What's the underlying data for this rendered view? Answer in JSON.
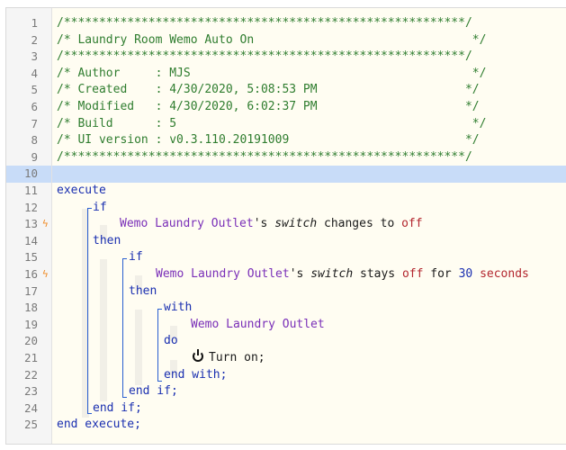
{
  "editor": {
    "line_numbers": [
      "1",
      "2",
      "3",
      "4",
      "5",
      "6",
      "7",
      "8",
      "9",
      "10",
      "11",
      "12",
      "13",
      "14",
      "15",
      "16",
      "17",
      "18",
      "19",
      "20",
      "21",
      "22",
      "23",
      "24",
      "25"
    ],
    "active_line": 10,
    "trigger_lines": [
      13,
      16
    ],
    "header": {
      "border": "/*********************************************************/",
      "title": "/* Laundry Room Wemo Auto On                               */",
      "author": "/* Author     : MJS                                        */",
      "created": "/* Created    : 4/30/2020, 5:08:53 PM                     */",
      "modified": "/* Modified   : 4/30/2020, 6:02:37 PM                     */",
      "build": "/* Build      : 5                                          */",
      "ui_version": "/* UI version : v0.3.110.20191009                         */"
    },
    "code": {
      "execute": "execute",
      "if": "if",
      "device": "Wemo Laundry Outlet",
      "possessive": "'s ",
      "switch": "switch",
      "changes_to": " changes to ",
      "off": "off",
      "then": "then",
      "stays": " stays ",
      "for": " for ",
      "thirty": "30",
      "seconds": " seconds",
      "with": "with",
      "do": "do",
      "turn_on": "Turn on;",
      "end_with": "end with;",
      "end_if": "end if;",
      "end_execute": "end execute;"
    },
    "colors": {
      "comment": "#2f7d2f",
      "keyword": "#1a2fb0",
      "device": "#7a2fb8",
      "value": "#b3262e",
      "trigger_icon": "#f08a24",
      "active_line": "#c8dcf8"
    }
  }
}
